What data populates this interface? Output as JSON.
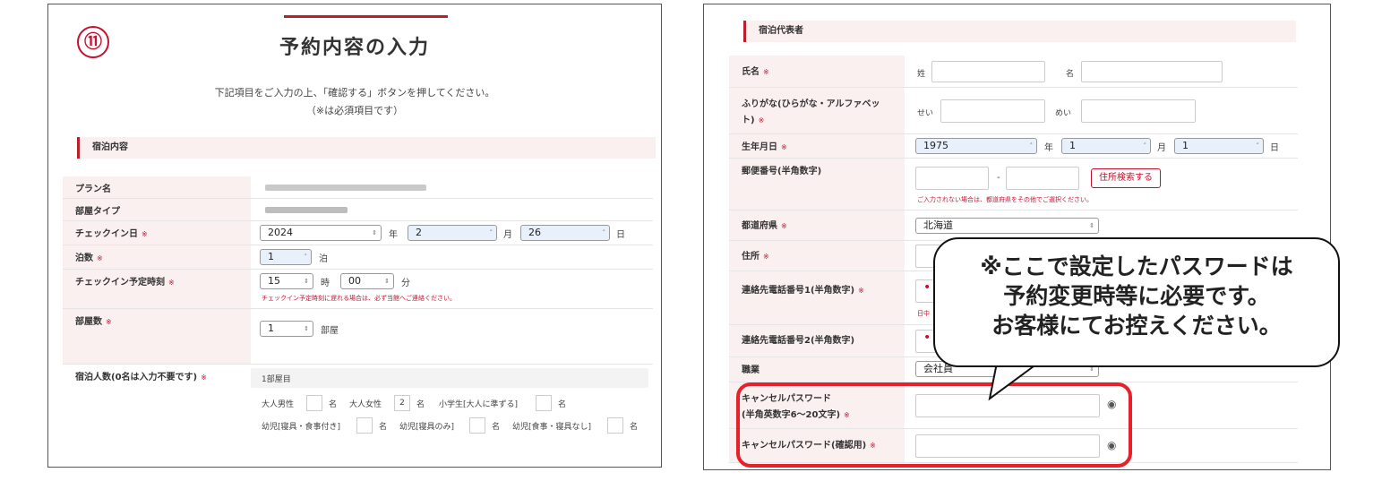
{
  "left": {
    "step_number": "⑪",
    "title": "予約内容の入力",
    "instruction": "下記項目をご入力の上、「確認する」ボタンを押してください。",
    "required_note": "（※は必須項目です）",
    "section": "宿泊内容",
    "req_mark": "※",
    "rows": {
      "plan": {
        "label": "プラン名"
      },
      "room_type": {
        "label": "部屋タイプ"
      },
      "checkin_date": {
        "label": "チェックイン日",
        "year": "2024",
        "year_unit": "年",
        "month": "2",
        "month_unit": "月",
        "day": "26",
        "day_unit": "日"
      },
      "nights": {
        "label": "泊数",
        "value": "1",
        "unit": "泊"
      },
      "checkin_time": {
        "label": "チェックイン予定時刻",
        "hour": "15",
        "hour_unit": "時",
        "minute": "00",
        "minute_unit": "分",
        "note": "チェックイン予定時刻に遅れる場合は、必ず当館へご連絡ください。"
      },
      "rooms": {
        "label": "部屋数",
        "value": "1",
        "unit": "部屋"
      },
      "guests": {
        "label": "宿泊人数(0名は入力不要です)",
        "room_label": "1部屋目",
        "adult_male": "大人男性",
        "adult_male_value": "",
        "adult_female": "大人女性",
        "adult_female_value": "2",
        "elementary": "小学生[大人に準ずる]",
        "elementary_value": "",
        "infant_bed_meal": "幼児[寝具・食事付き]",
        "infant_bed_meal_value": "",
        "infant_bed": "幼児[寝具のみ]",
        "infant_bed_value": "",
        "infant_none": "幼児[食事・寝具なし]",
        "infant_none_value": "",
        "person_unit": "名"
      }
    }
  },
  "right": {
    "section": "宿泊代表者",
    "req_mark": "※",
    "rows": {
      "name": {
        "label": "氏名",
        "sei": "姓",
        "mei": "名"
      },
      "kana": {
        "label": "ふりがな(ひらがな・アルファベット)",
        "sei": "せい",
        "mei": "めい"
      },
      "birthdate": {
        "label": "生年月日",
        "year": "1975",
        "year_unit": "年",
        "month": "1",
        "month_unit": "月",
        "day": "1",
        "day_unit": "日"
      },
      "postal": {
        "label": "郵便番号(半角数字)",
        "dash": "-",
        "search_button": "住所検索する",
        "note": "ご入力されない場合は、都道府県をその他でご選択ください。"
      },
      "prefecture": {
        "label": "都道府県",
        "value": "北海道"
      },
      "address": {
        "label": "住所"
      },
      "phone1": {
        "label": "連絡先電話番号1(半角数字)",
        "note": "日中"
      },
      "phone2": {
        "label": "連絡先電話番号2(半角数字)"
      },
      "occupation": {
        "label": "職業",
        "value": "会社員"
      },
      "cancel_pw": {
        "label1": "キャンセルパスワード",
        "label2": "(半角英数字6～20文字)"
      },
      "cancel_pw_confirm": {
        "label": "キャンセルパスワード(確認用)"
      }
    }
  },
  "callout": {
    "line1": "※ここで設定したパスワードは",
    "line2": "予約変更時等に必要です。",
    "line3": "お客様にてお控えください。"
  },
  "colors": {
    "accent": "#b8212c",
    "highlight": "#e8202a",
    "label_bg": "#fbf0f0"
  }
}
